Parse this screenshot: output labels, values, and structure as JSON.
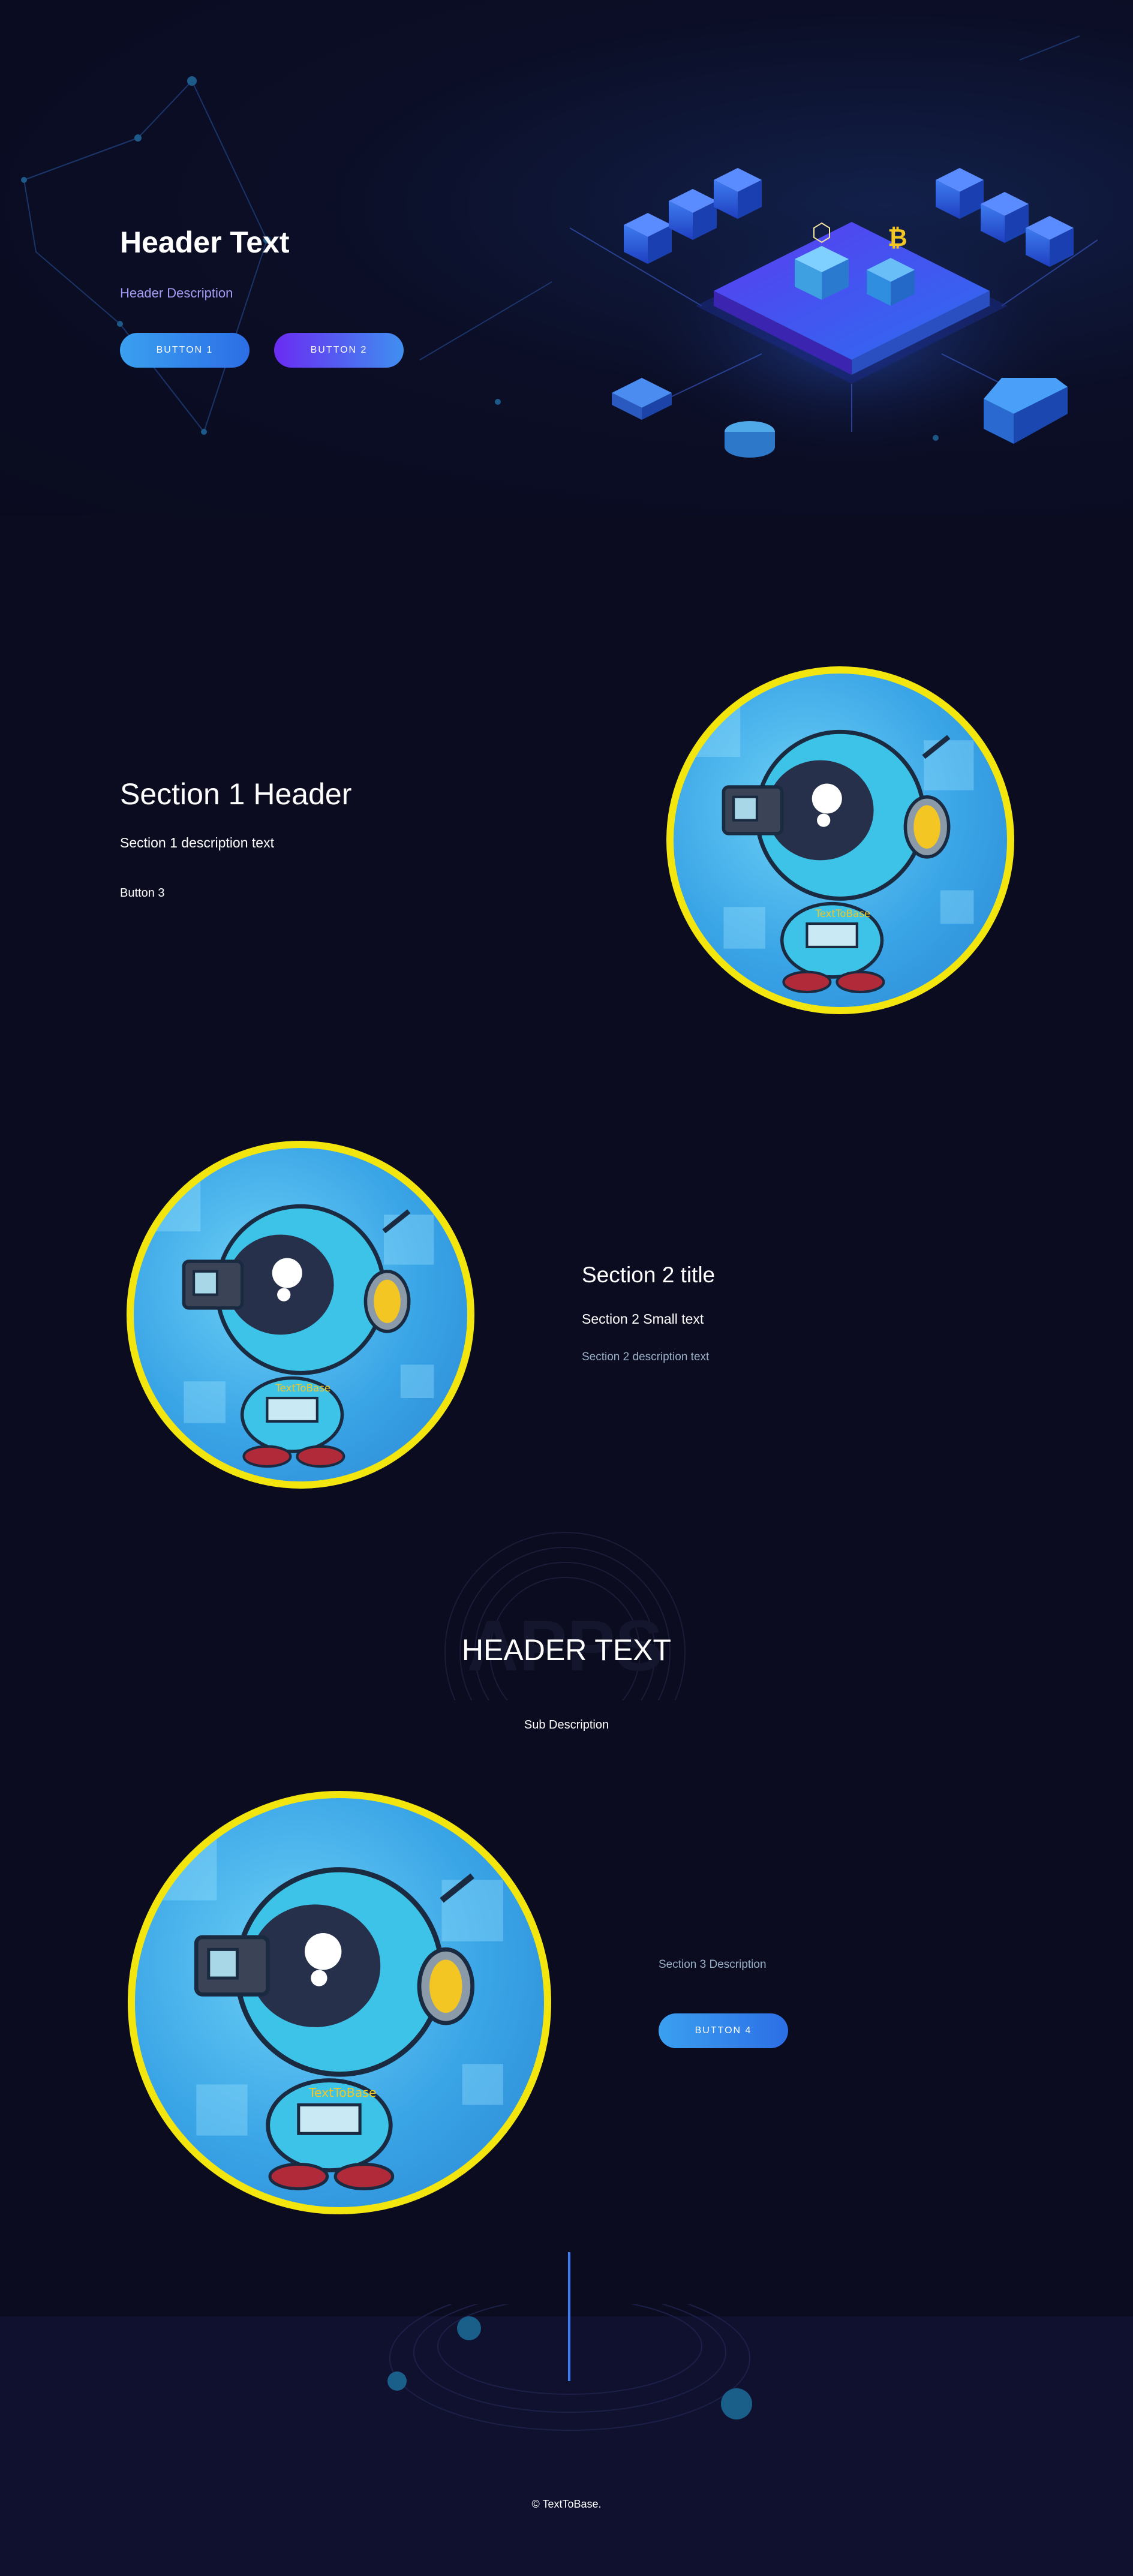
{
  "hero": {
    "title": "Header Text",
    "description": "Header Description",
    "button1": "BUTTON 1",
    "button2": "BUTTON 2"
  },
  "section1": {
    "header": "Section 1 Header",
    "description": "Section 1 description text",
    "button3": "Button 3"
  },
  "section2": {
    "title": "Section 2 title",
    "small_text": "Section 2 Small text",
    "description": "Section 2 description text"
  },
  "apps_section": {
    "background_word": "APPS",
    "header": "HEADER TEXT",
    "sub_description": "Sub Description"
  },
  "section3": {
    "description": "Section 3 Description",
    "button4": "BUTTON 4"
  },
  "mascot_shirt_text": "TextToBase",
  "footer": {
    "copyright": "© TextToBase."
  },
  "colors": {
    "background": "#0b0c20",
    "accent_purple": "#a69cf5",
    "accent_blue": "#3b7ff2",
    "ring_yellow": "#f3e60f",
    "muted_text": "#9ab0c8"
  }
}
